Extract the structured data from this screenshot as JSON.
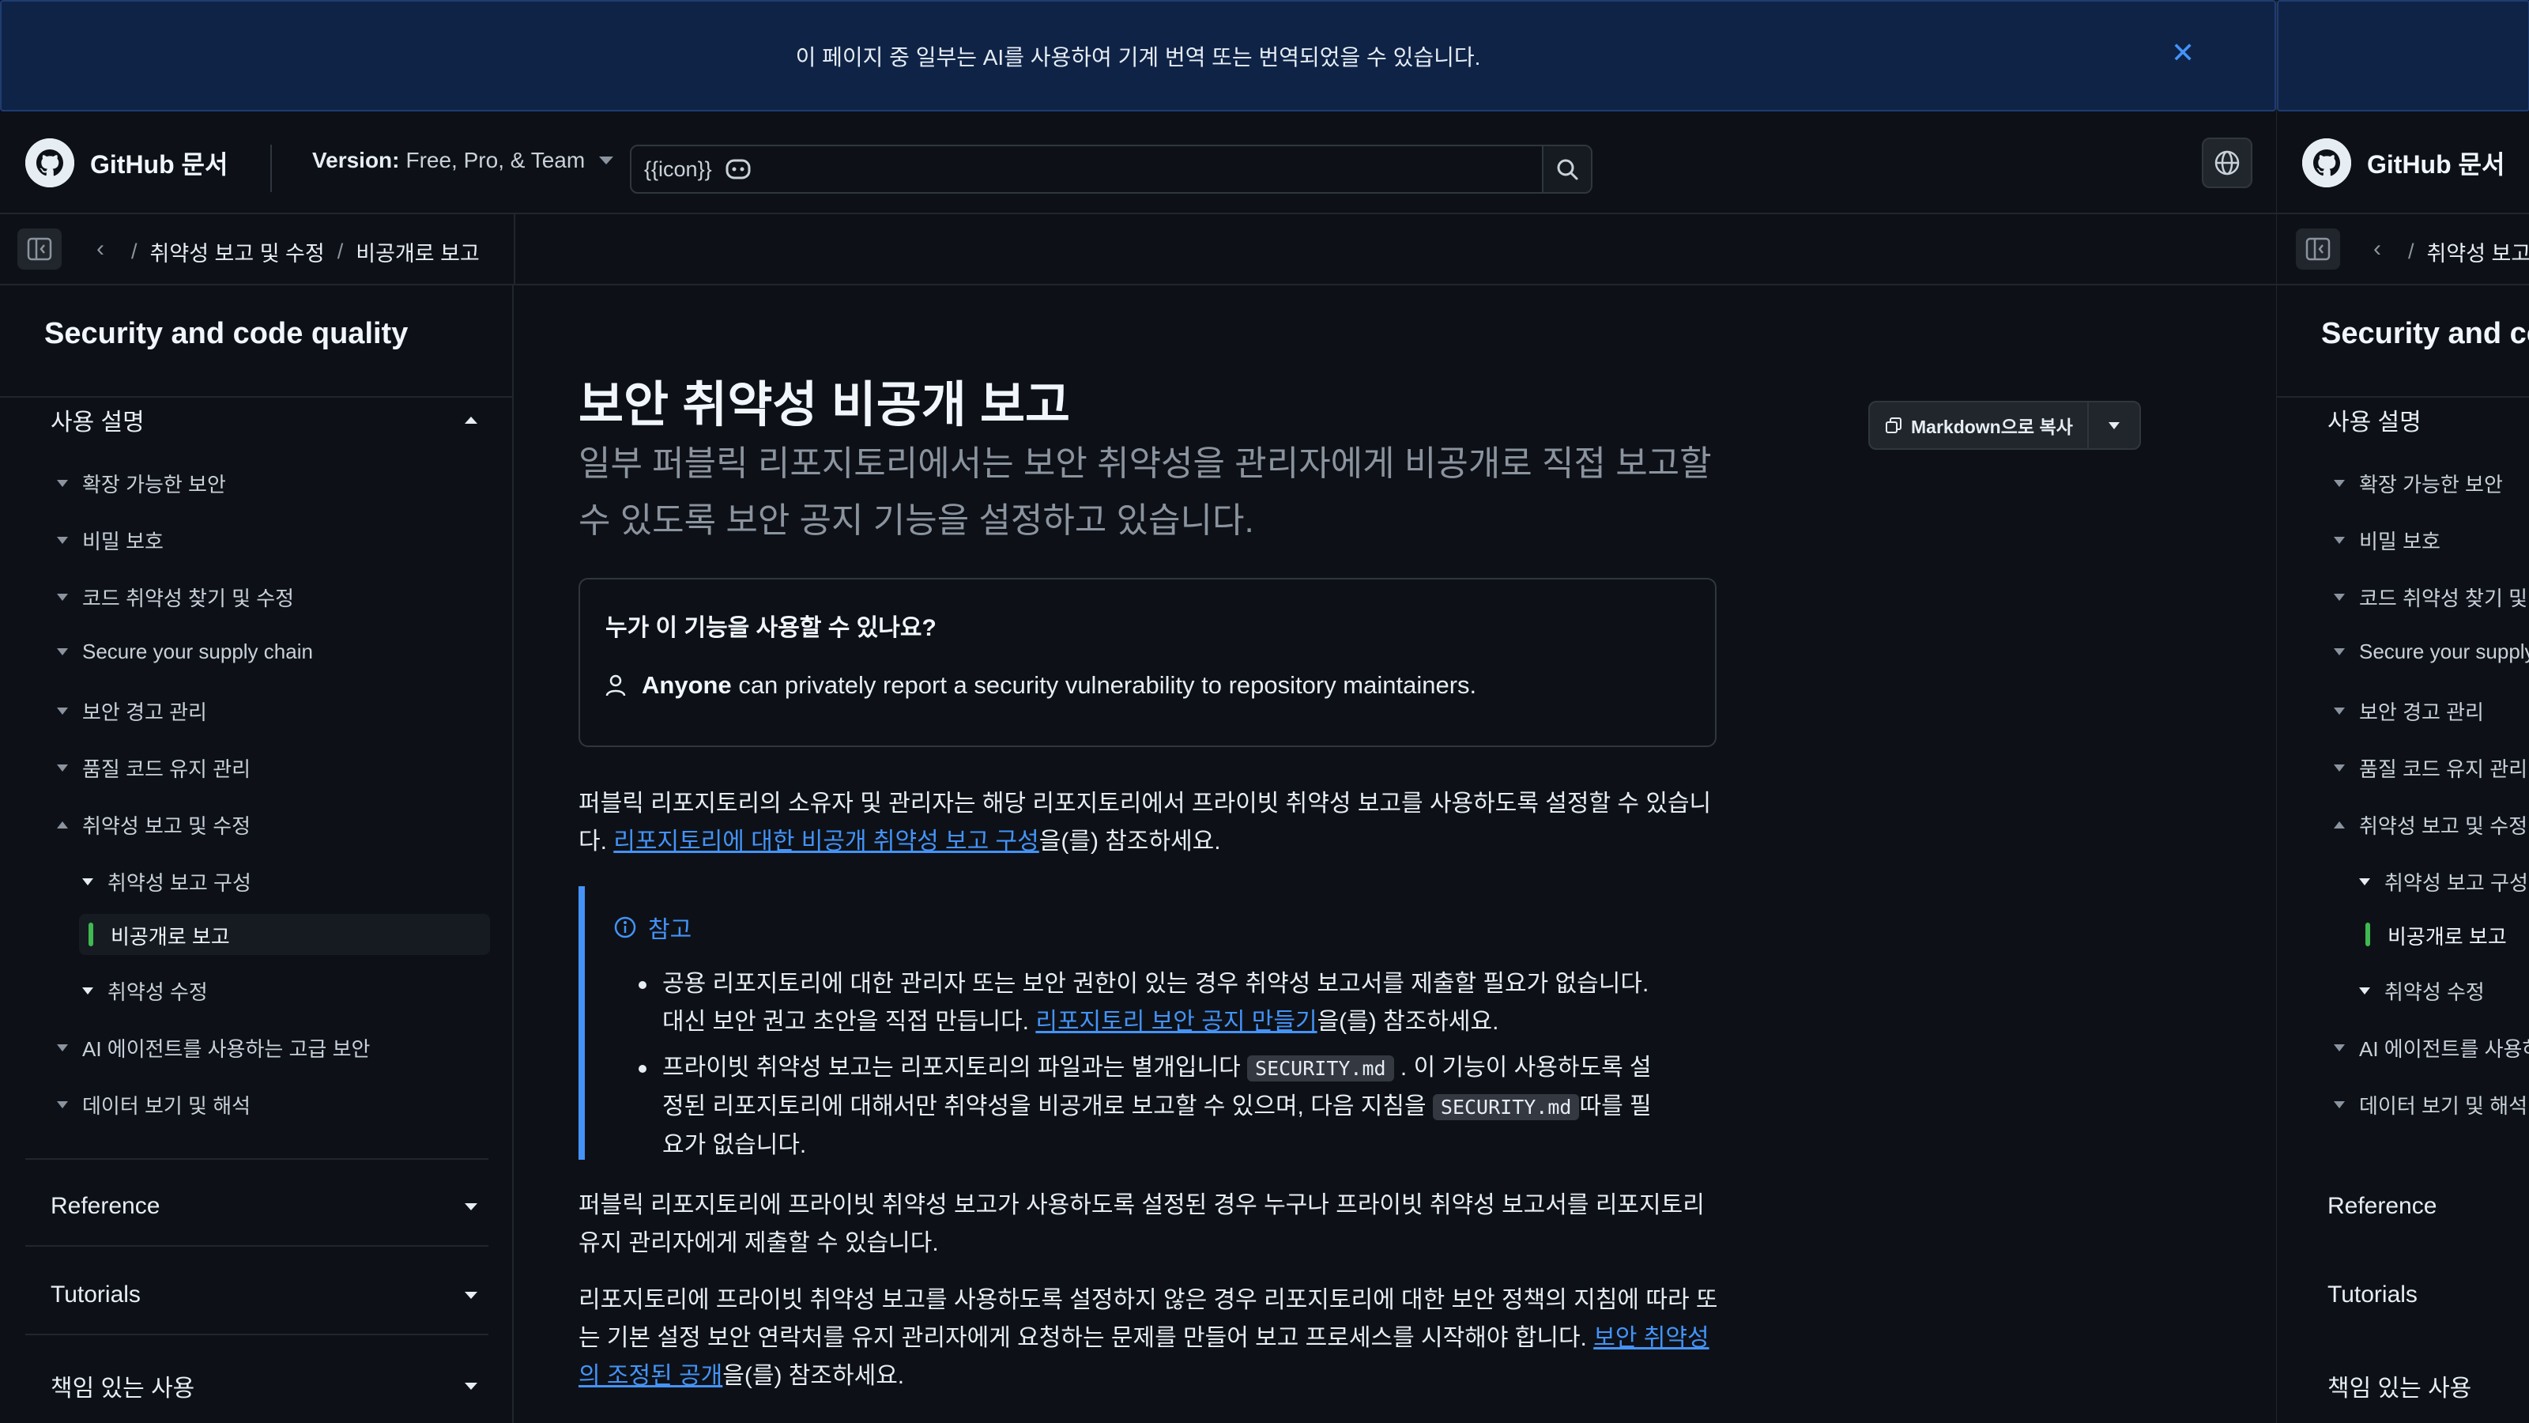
{
  "banner": {
    "text": "이 페이지 중 일부는 AI를 사용하여 기계 번역 또는 번역되었을 수 있습니다.",
    "close_icon": "close-icon"
  },
  "header": {
    "site_title": "GitHub 문서",
    "version_label": "Version:",
    "version_value": "Free, Pro, & Team",
    "search_placeholder": "{{icon}}",
    "search_icon": "search-icon",
    "language_icon": "globe-icon"
  },
  "breadcrumb": {
    "items": [
      "취약성 보고 및 수정",
      "비공개로 보고"
    ]
  },
  "sidebar": {
    "title": "Security and code quality",
    "section_open": "사용 설명",
    "items": [
      "확장 가능한 보안",
      "비밀 보호",
      "코드 취약성 찾기 및 수정",
      "Secure your supply chain",
      "보안 경고 관리",
      "품질 코드 유지 관리",
      "취약성 보고 및 수정",
      "취약성 보고 구성",
      "비공개로 보고",
      "취약성 수정",
      "AI 에이전트를 사용하는 고급 보안",
      "데이터 보기 및 해석"
    ],
    "collapsed_sections": [
      "Reference",
      "Tutorials",
      "책임 있는 사용"
    ]
  },
  "article": {
    "title": "보안 취약성 비공개 보고",
    "lead": "일부 퍼블릭 리포지토리에서는 보안 취약성을 관리자에게 비공개로 직접 보고할 수 있도록 보안 공지 기능을 설정하고 있습니다.",
    "copy_button": "Markdown으로 복사",
    "who_question": "누가 이 기능을 사용할 수 있나요?",
    "who_bold": "Anyone",
    "who_rest": "can privately report a security vulnerability to repository maintainers.",
    "p1_text": "퍼블릭 리포지토리의 소유자 및 관리자는 해당 리포지토리에서 프라이빗 취약성 보고를 사용하도록 설정할 수 있습니다. ",
    "p1_link": "리포지토리에 대한 비공개 취약성 보고 구성",
    "p1_suffix": "을(를) 참조하세요.",
    "note_title": "참고",
    "note_1_text": "공용 리포지토리에 대한 관리자 또는 보안 권한이 있는 경우 취약성 보고서를 제출할 필요가 없습니다. 대신 보안 권고 초안을 직접 만듭니다. ",
    "note_1_link": "리포지토리 보안 공지 만들기",
    "note_1_suffix": "을(를) 참조하세요.",
    "note_2_a": "프라이빗 취약성 보고는 리포지토리의 파일과는 별개입니다 ",
    "note_2_code": "SECURITY.md",
    "note_2_b": " . 이 기능이 사용하도록 설정된 리포지토리에 대해서만 취약성을 비공개로 보고할 수 있으며, 다음 지침을 ",
    "note_2_c": "따를 필요가 없습니다.",
    "p2": "퍼블릭 리포지토리에 프라이빗 취약성 보고가 사용하도록 설정된 경우 누구나 프라이빗 취약성 보고서를 리포지토리 유지 관리자에게 제출할 수 있습니다.",
    "p3_text": "리포지토리에 프라이빗 취약성 보고를 사용하도록 설정하지 않은 경우 리포지토리에 대한 보안 정책의 지침에 따라 또는 기본 설정 보안 연락처를 유지 관리자에게 요청하는 문제를 만들어 보고 프로세스를 시작해야 합니다. ",
    "p3_link": "보안 취약성의 조정된 공개",
    "p3_suffix": "을(를) 참조하세요."
  },
  "colors": {
    "accent": "#4493f8",
    "active_marker": "#3fb950",
    "banner_bg": "#0f2347"
  }
}
